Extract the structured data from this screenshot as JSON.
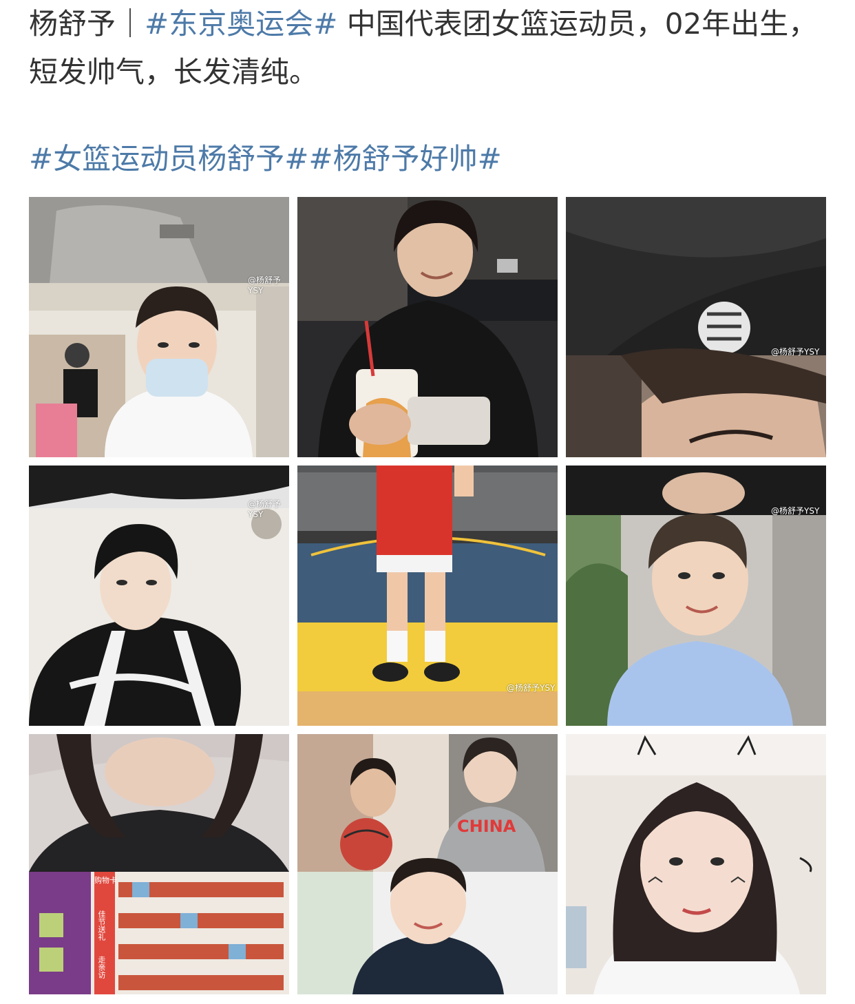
{
  "post": {
    "author": "杨舒予",
    "separator": "｜",
    "topic1": "#东京奥运会#",
    "text": " 中国代表团女篮运动员，02年出生，短发帅气，长发清纯。",
    "topic2": "#女篮运动员杨舒予#",
    "topic3": "#杨舒予好帅#"
  },
  "images": [
    {
      "name": "photo-hoodie-mask-supermarket",
      "watermark": "@杨舒予YSY"
    },
    {
      "name": "photo-night-street-drink",
      "watermark": ""
    },
    {
      "name": "photo-north-face-jacket-closeup",
      "watermark": "@杨舒予YSY"
    },
    {
      "name": "photo-beanie-varsity-jacket",
      "watermark": "@杨舒予YSY"
    },
    {
      "name": "photo-basketball-court-legs",
      "watermark": "@杨舒予YSY"
    },
    {
      "name": "photo-blue-tshirt-selfie",
      "watermark": "@杨舒予YSY"
    },
    {
      "name": "photo-supermarket-long-hair",
      "watermark": ""
    },
    {
      "name": "photo-team-china-shirt",
      "watermark": ""
    },
    {
      "name": "photo-long-hair-doodle-selfie",
      "watermark": ""
    }
  ],
  "tile7_labels": {
    "shelf_sign": "购物卡",
    "sign_1": "佳节送礼",
    "sign_2": "走亲访"
  },
  "tile8_labels": {
    "shirt_text": "CHINA"
  },
  "colors": {
    "topic": "#4d7aa8",
    "text": "#333333"
  }
}
